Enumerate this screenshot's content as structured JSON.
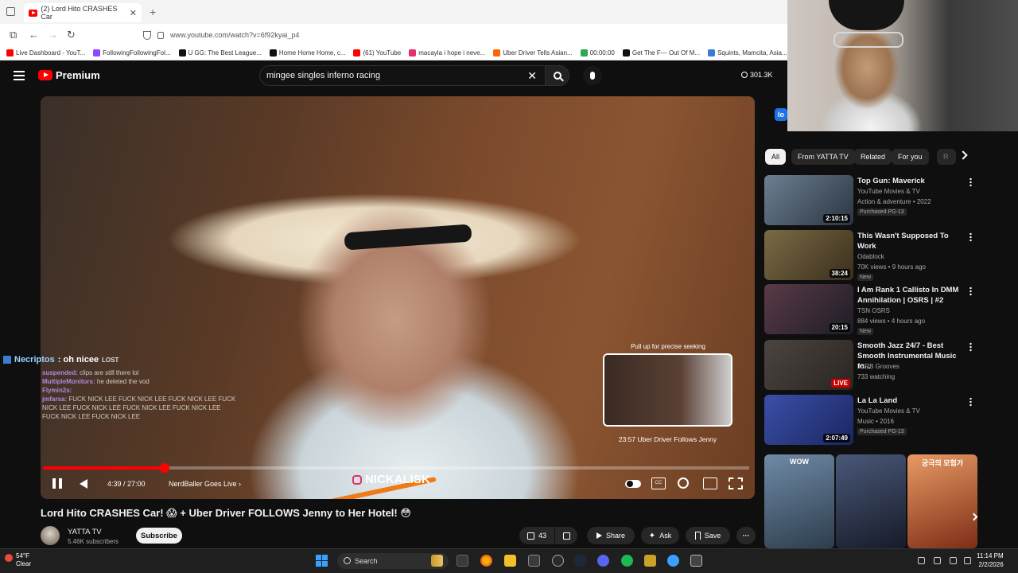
{
  "browser": {
    "tab_title": "(2) Lord Hito CRASHES Car",
    "url": "www.youtube.com/watch?v=6f92kyai_p4",
    "bookmarks": [
      {
        "label": "Live Dashboard - YouT...",
        "color": "#ff0000"
      },
      {
        "label": "FollowingFollowingFol...",
        "color": "#9146ff"
      },
      {
        "label": "U GG: The Best League...",
        "color": "#111111"
      },
      {
        "label": "Home Home Home, c...",
        "color": "#111111"
      },
      {
        "label": "(61) YouTube",
        "color": "#ff0000"
      },
      {
        "label": "macayla i hope i neve...",
        "color": "#e1306c"
      },
      {
        "label": "Uber Driver Tells Asian...",
        "color": "#ff6600"
      },
      {
        "label": "00:00:00",
        "color": "#2fa84f"
      },
      {
        "label": "Get The F--- Out Of M...",
        "color": "#111111"
      },
      {
        "label": "Squints, Mamcita, Asia...",
        "color": "#3b7bd1"
      }
    ]
  },
  "header": {
    "logo_text": "Premium",
    "search_value": "mingee singles inferno racing",
    "stat_value": "301.3K"
  },
  "player": {
    "chat_header_user": "Necriptos",
    "chat_header_msg": ": oh nicee",
    "chat_header_tag": "LOST",
    "chat_lines": [
      {
        "user": "suspended:",
        "text": "clips are still there lol"
      },
      {
        "user": "MultipleMonitors:",
        "text": "he deleted the vod"
      },
      {
        "user": "Flymin2s:",
        "text": ""
      },
      {
        "user": "jmfarsa:",
        "text": "FUCK NICK LEE FUCK NICK LEE FUCK NICK LEE FUCK NICK LEE FUCK NICK LEE FUCK NICK LEE FUCK NICK LEE FUCK NICK LEE FUCK NICK LEE"
      }
    ],
    "preview_hint": "Pull up for precise seeking",
    "preview_label": "23:57  Uber Driver Follows Jenny",
    "progress_fraction": 0.172,
    "time_text": "4:39 / 27:00",
    "chapter_text": "NerdBaller Goes Live",
    "watermark_text": "NICKALISK"
  },
  "video_info": {
    "title": "Lord Hito CRASHES Car! 😱 + Uber Driver FOLLOWS Jenny to Her Hotel! 😳",
    "channel_name": "YATTA TV",
    "channel_subs": "5.46K subscribers",
    "subscribe_label": "Subscribe",
    "like_count": "43",
    "share_label": "Share",
    "ask_label": "Ask",
    "save_label": "Save"
  },
  "webcam_badge": "lo",
  "chips": [
    "All",
    "From YATTA TV",
    "Related",
    "For you",
    "R"
  ],
  "recommendations": [
    {
      "title": "Top Gun: Maverick",
      "meta1": "YouTube Movies & TV",
      "meta2": "Action & adventure • 2022",
      "badge": "Purchased  PG-13",
      "duration": "2:10:15",
      "thumb_a": "#6d7f92",
      "thumb_b": "#2a3540"
    },
    {
      "title": "This Wasn't Supposed To Work",
      "meta1": "Odablock",
      "meta2": "70K views • 9 hours ago",
      "badge": "New",
      "duration": "38:24",
      "thumb_a": "#7a6a45",
      "thumb_b": "#3b2f1c"
    },
    {
      "title": "I Am Rank 1 Callisto In DMM Annihilation | OSRS | #2",
      "meta1": "TSN OSRS",
      "meta2": "884 views • 4 hours ago",
      "badge": "New",
      "duration": "20:15",
      "thumb_a": "#5a3a48",
      "thumb_b": "#1d1d26"
    },
    {
      "title": "Smooth Jazz 24/7 - Best Smooth Instrumental Music fo...",
      "meta1": "JSRB Grooves",
      "meta2": "733 watching",
      "badge": "",
      "duration": "LIVE",
      "thumb_a": "#4b4540",
      "thumb_b": "#2a2522"
    },
    {
      "title": "La La Land",
      "meta1": "YouTube Movies & TV",
      "meta2": "Music • 2016",
      "badge": "Purchased  PG-13",
      "duration": "2:07:49",
      "thumb_a": "#3a4fa8",
      "thumb_b": "#1b2660"
    }
  ],
  "shorts": [
    {
      "label": "WOW",
      "color_a": "#6f8aa6",
      "color_b": "#2d3d4d"
    },
    {
      "label": "",
      "color_a": "#4a5878",
      "color_b": "#161b29"
    },
    {
      "label": "궁극의 모험가",
      "color_a": "#e89a64",
      "color_b": "#7d2d16"
    }
  ],
  "taskbar": {
    "weather_temp": "54°F",
    "weather_desc": "Clear",
    "search_placeholder": "Search",
    "time": "11:14 PM",
    "date": "2/2/2026"
  }
}
